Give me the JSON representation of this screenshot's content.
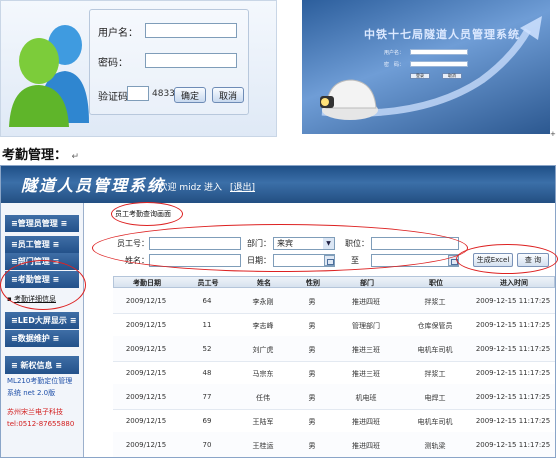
{
  "login": {
    "username_label": "用户名：",
    "password_label": "密码：",
    "captcha_label": "验证码",
    "captcha_code": "4833",
    "confirm_label": "确定",
    "cancel_label": "取消"
  },
  "splash": {
    "title": "中铁十七局隧道人员管理系统",
    "username_label": "用户名：",
    "password_label": "密　码：",
    "login_label": "登录",
    "cancel_label": "取消"
  },
  "section_heading": "考勤管理：",
  "section_return_mark": "↵",
  "corner_mark": "+",
  "app": {
    "title": "隧道人员管理系统",
    "welcome_text": "→欢迎 midz 进入",
    "logout_label": "[退出]",
    "menu": [
      {
        "label": "≡管理员管理 ≡"
      },
      {
        "label": "≡员工管理 ≡"
      },
      {
        "label": "≡部门管理 ≡"
      },
      {
        "label": "≡考勤管理 ≡"
      },
      {
        "label": "≡LED大屏显示 ≡"
      },
      {
        "label": "≡数据维护 ≡"
      },
      {
        "label": "≡ 新权信息 ≡"
      }
    ],
    "submenu_item": "考勤详细信息",
    "side_notes": {
      "line1": "ML210考勤定位管理",
      "line2": "系统 net 2.0版",
      "company": "苏州宋兰电子科技",
      "phone": "tel:0512-87655880"
    },
    "content": {
      "tab_title": "员工考勤查询画面",
      "filters": {
        "emp_no_label": "员工号：",
        "dept_label": "部门：",
        "dept_value": "来宾",
        "position_label": "职位：",
        "name_label": "姓名：",
        "date_label": "日期：",
        "to_label": "至",
        "export_label": "生成Excel",
        "query_label": "查 询"
      },
      "columns": [
        "考勤日期",
        "员工号",
        "姓名",
        "性别",
        "部门",
        "职位",
        "进入时间"
      ],
      "rows": [
        [
          "2009/12/15",
          "64",
          "李永刚",
          "男",
          "推进四班",
          "拌浆工",
          "2009-12-15 11:17:25"
        ],
        [
          "2009/12/15",
          "11",
          "李志峰",
          "男",
          "管理部门",
          "仓库保管员",
          "2009-12-15 11:17:25"
        ],
        [
          "2009/12/15",
          "52",
          "刘广虎",
          "男",
          "推进三班",
          "电机车司机",
          "2009-12-15 11:17:25"
        ],
        [
          "2009/12/15",
          "48",
          "马宗东",
          "男",
          "推进三班",
          "拌浆工",
          "2009-12-15 11:17:25"
        ],
        [
          "2009/12/15",
          "77",
          "任伟",
          "男",
          "机电班",
          "电焊工",
          "2009-12-15 11:17:25"
        ],
        [
          "2009/12/15",
          "69",
          "王陆军",
          "男",
          "推进四班",
          "电机车司机",
          "2009-12-15 11:17:25"
        ],
        [
          "2009/12/15",
          "70",
          "王桂运",
          "男",
          "推进四班",
          "测轨梁",
          "2009-12-15 11:17:25"
        ]
      ]
    }
  }
}
